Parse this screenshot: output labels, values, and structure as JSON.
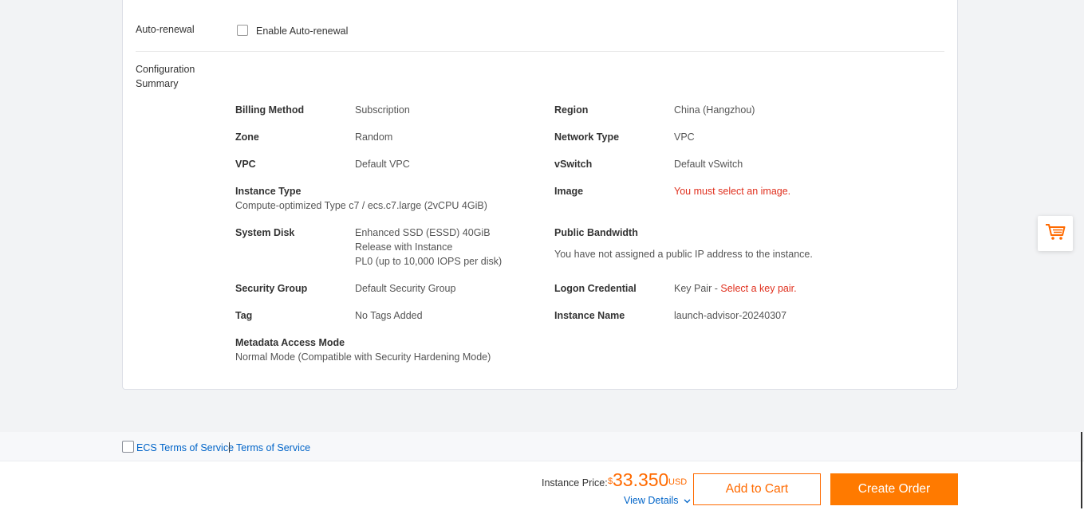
{
  "auto_renewal": {
    "label": "Auto-renewal",
    "checkbox_text": "Enable Auto-renewal"
  },
  "summary": {
    "title": "Configuration Summary",
    "billing_method_label": "Billing Method",
    "billing_method_value": "Subscription",
    "region_label": "Region",
    "region_value": "China (Hangzhou)",
    "zone_label": "Zone",
    "zone_value": "Random",
    "network_type_label": "Network Type",
    "network_type_value": "VPC",
    "vpc_label": "VPC",
    "vpc_value": "Default VPC",
    "vswitch_label": "vSwitch",
    "vswitch_value": "Default vSwitch",
    "instance_type_label": "Instance Type",
    "instance_type_value": "Compute-optimized Type c7 / ecs.c7.large (2vCPU 4GiB)",
    "image_label": "Image",
    "image_value": "You must select an image.",
    "system_disk_label": "System Disk",
    "system_disk_line1": "Enhanced SSD (ESSD) 40GiB",
    "system_disk_line2": "Release with Instance",
    "system_disk_line3": "PL0 (up to 10,000 IOPS per disk)",
    "public_bandwidth_label": "Public Bandwidth",
    "public_bandwidth_value": "You have not assigned a public IP address to the instance.",
    "security_group_label": "Security Group",
    "security_group_value": "Default Security Group",
    "logon_credential_label": "Logon Credential",
    "logon_credential_prefix": "Key Pair -",
    "logon_credential_error": "Select a key pair.",
    "tag_label": "Tag",
    "tag_value": "No Tags Added",
    "instance_name_label": "Instance Name",
    "instance_name_value": "launch-advisor-20240307",
    "metadata_label": "Metadata Access Mode",
    "metadata_value": "Normal Mode (Compatible with Security Hardening Mode)"
  },
  "footer": {
    "ecs_terms": "ECS Terms of Service",
    "terms": "Terms of Service",
    "price_label": "Instance Price:",
    "currency_symbol": "$",
    "price_value": "33.350",
    "price_unit": "USD",
    "view_details": "View Details",
    "add_to_cart": "Add to Cart",
    "create_order": "Create Order"
  },
  "icons": {
    "cart": "shopping-cart-icon",
    "chevron": "chevron-down-icon"
  },
  "colors": {
    "accent": "#ff6a00",
    "link": "#0064c8",
    "error": "#e0301e"
  }
}
